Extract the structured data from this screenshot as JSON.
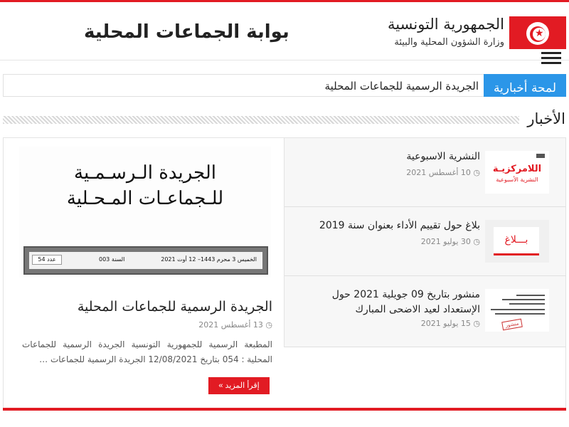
{
  "header": {
    "republic": "الجمهورية التونسية",
    "ministry": "وزارة الشؤون المحلية والبيئة",
    "portal_title": "بوابة الجماعات المحلية",
    "flag_icon": "tunisia-flag-icon",
    "menu_icon": "hamburger-menu-icon"
  },
  "ticker": {
    "label": "لمحة أخبارية",
    "text": "الجريدة الرسمية للجماعات المحلية"
  },
  "section": {
    "title": "الأخبار"
  },
  "featured": {
    "image": {
      "line1": "الجريدة الـرسـمـية",
      "line2": "للـجماعـات المـحـلية",
      "date_text": "الخميس 3 محرم 1443– 12 أوت 2021",
      "year_text": "السنة 003",
      "issue_text": "عدد 54"
    },
    "title": "الجريدة الرسمية للجماعات المحلية",
    "date": "13 أغسطس 2021",
    "excerpt": "المطبعة الرسمية للجمهورية التونسية الجريدة الرسمية للجماعات المحلية : 054 بتاريخ 12/08/2021 الجريدة الرسمية للجماعات …",
    "read_more": "إقرأ المزيد »"
  },
  "news_list": [
    {
      "title": "النشرية الاسبوعية",
      "date": "10 أغسطس 2021",
      "thumb_title": "اللامركزيـة",
      "thumb_sub": "النشرية الأسبوعية"
    },
    {
      "title": "بلاغ حول تقييم الأداء بعنوان سنة 2019",
      "date": "30 يوليو 2021",
      "thumb_title": "بـــلاغ"
    },
    {
      "title": "منشور بتاريخ 09 جويلية 2021 حول الإستعداد لعيد الاضحى المبارك",
      "date": "15 يوليو 2021",
      "thumb_stamp": "منشور"
    }
  ],
  "colors": {
    "accent_red": "#e21b23",
    "ticker_blue": "#2b96e8"
  },
  "clock_icon": "◷"
}
